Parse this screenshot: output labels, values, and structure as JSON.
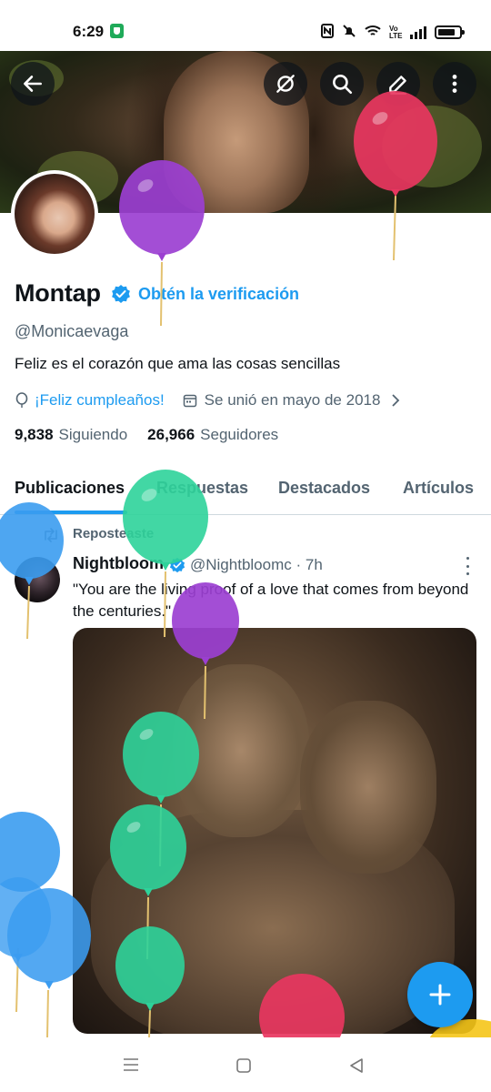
{
  "status_bar": {
    "time": "6:29",
    "network_label": "Vo LTE"
  },
  "header": {
    "back_icon": "arrow-left-icon",
    "sparkle_icon": "grok-icon",
    "search_icon": "search-icon",
    "edit_icon": "edit-icon",
    "more_icon": "more-vertical-icon"
  },
  "profile": {
    "name": "Montap",
    "get_verified": "Obtén la verificación",
    "handle": "@Monicaevaga",
    "bio": "Feliz es el corazón que ama las cosas sencillas",
    "birthday": "¡Feliz cumpleaños!",
    "joined": "Se unió en mayo de 2018",
    "following_count": "9,838",
    "following_label": "Siguiendo",
    "followers_count": "26,966",
    "followers_label": "Seguidores"
  },
  "tabs": [
    {
      "label": "Publicaciones"
    },
    {
      "label": "Respuestas"
    },
    {
      "label": "Destacados"
    },
    {
      "label": "Artículos"
    }
  ],
  "post": {
    "repost_label": "Reposteaste",
    "author_name": "Nightbloom",
    "author_handle": "@Nightbloomc",
    "time": "· 7h",
    "text": "\"You are the living proof of a love that comes from beyond the centuries.\""
  },
  "fab": {
    "icon": "plus-icon"
  },
  "colors": {
    "accent": "#1d9bf0",
    "balloon_purple": "#9b3fd1",
    "balloon_red": "#e8365f",
    "balloon_green": "#2ed39a",
    "balloon_blue": "#3b9cf0",
    "balloon_yellow": "#f5c518"
  }
}
